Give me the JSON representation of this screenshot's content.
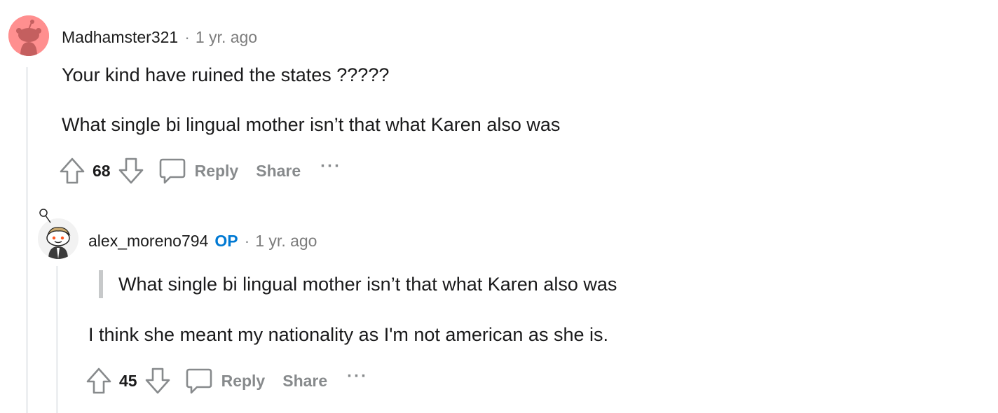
{
  "comments": [
    {
      "username": "Madhamster321",
      "separator": "·",
      "timestamp": "1 yr. ago",
      "avatar_icon": "snoo-avatar-pink",
      "avatar_color": "#ff8f8f",
      "paragraphs": [
        "Your kind have ruined the states ?????",
        "What single bi lingual mother isn’t that what Karen also was"
      ],
      "votes": "68",
      "reply_label": "Reply",
      "share_label": "Share",
      "more_label": "···"
    },
    {
      "username": "alex_moreno794",
      "op_badge": "OP",
      "separator": "·",
      "timestamp": "1 yr. ago",
      "avatar_icon": "snoo-avatar-custom",
      "quote": "What single bi lingual mother isn’t that what Karen also was",
      "paragraphs": [
        "I think she meant my nationality as I'm not american as she is."
      ],
      "votes": "45",
      "reply_label": "Reply",
      "share_label": "Share",
      "more_label": "···"
    }
  ],
  "colors": {
    "op_accent": "#0079d3",
    "muted_text": "#878a8c",
    "thread_line": "#edeff1",
    "quote_bar": "#c7c9ca"
  }
}
